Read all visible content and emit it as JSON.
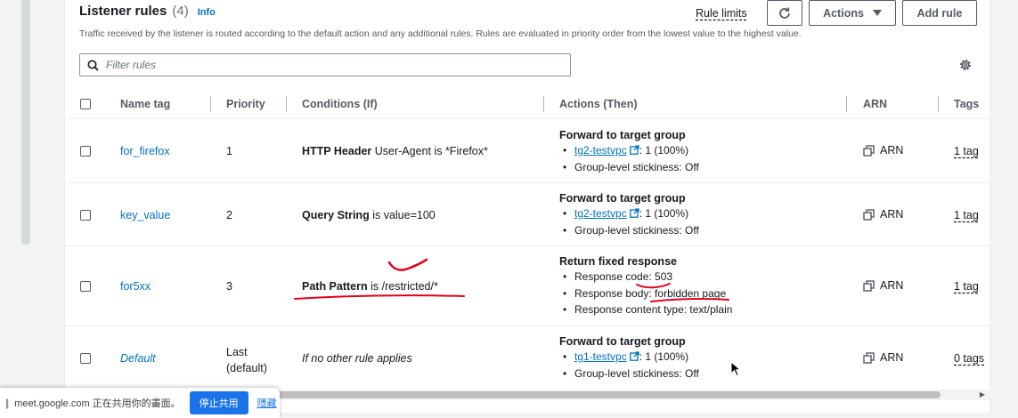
{
  "header": {
    "title": "Listener rules",
    "count": "(4)",
    "info_label": "Info",
    "description": "Traffic received by the listener is routed according to the default action and any additional rules. Rules are evaluated in priority order from the lowest value to the highest value.",
    "rule_limits_label": "Rule limits",
    "actions_label": "Actions",
    "add_rule_label": "Add rule"
  },
  "search": {
    "placeholder": "Filter rules"
  },
  "table": {
    "columns": [
      "Name tag",
      "Priority",
      "Conditions (If)",
      "Actions (Then)",
      "ARN",
      "Tags"
    ],
    "rows": [
      {
        "name": "for_firefox",
        "priority": "1",
        "condition_key": "HTTP Header",
        "condition_value": "User-Agent is *Firefox*",
        "action_title": "Forward to target group",
        "target_group": "tg2-testvpc",
        "target_weight": ": 1 (100%)",
        "stickiness": "Group-level stickiness: Off",
        "arn_label": "ARN",
        "tags": "1 tag"
      },
      {
        "name": "key_value",
        "priority": "2",
        "condition_key": "Query String",
        "condition_value": "is value=100",
        "action_title": "Forward to target group",
        "target_group": "tg2-testvpc",
        "target_weight": ": 1 (100%)",
        "stickiness": "Group-level stickiness: Off",
        "arn_label": "ARN",
        "tags": "1 tag"
      },
      {
        "name": "for5xx",
        "priority": "3",
        "condition_key": "Path Pattern",
        "condition_value": "is /restricted/*",
        "action_title": "Return fixed response",
        "response_code": "Response code: 503",
        "response_body": "Response body: forbidden page",
        "content_type": "Response content type: text/plain",
        "arn_label": "ARN",
        "tags": "1 tag"
      },
      {
        "name": "Default",
        "priority_line1": "Last",
        "priority_line2": "(default)",
        "condition_text": "If no other rule applies",
        "action_title": "Forward to target group",
        "target_group": "tg1-testvpc",
        "target_weight": ": 1 (100%)",
        "stickiness": "Group-level stickiness: Off",
        "arn_label": "ARN",
        "tags": "0 tags"
      }
    ]
  },
  "share_bar": {
    "text": "meet.google.com 正在共用你的畫面。",
    "stop_label": "停止共用",
    "hide_label": "隱藏"
  },
  "colors": {
    "link": "#0073bb",
    "annotation": "#e0001b",
    "share_button": "#1a73e8"
  },
  "icons": [
    "refresh-icon",
    "caret-down-icon",
    "search-icon",
    "gear-icon",
    "external-link-icon",
    "copy-icon"
  ]
}
